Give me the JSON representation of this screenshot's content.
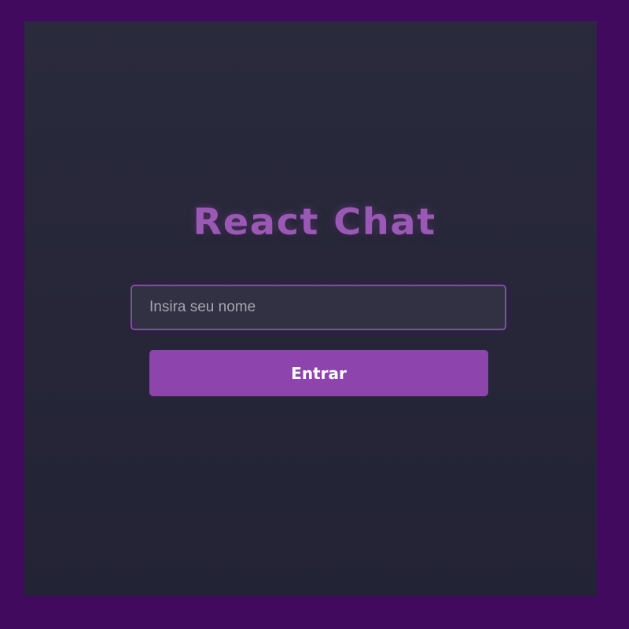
{
  "app": {
    "title": "React Chat"
  },
  "login": {
    "name_placeholder": "Insira seu nome",
    "name_value": "",
    "submit_label": "Entrar"
  },
  "colors": {
    "frame": "#420a5e",
    "background": "#262638",
    "accent": "#8e44ad",
    "title": "#9b59b6",
    "input_background": "#313143"
  }
}
